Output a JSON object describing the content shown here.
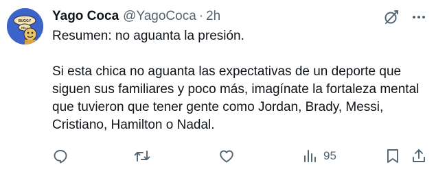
{
  "tweet": {
    "display_name": "Yago Coca",
    "handle": "@YagoCoca",
    "separator": "·",
    "time": "2h",
    "avatar_icon": "cartoon-character-avatar",
    "text": "Resumen: no aguanta la presión.\n\nSi esta chica no aguanta las expectativas de un deporte que siguen sus familiares y poco más, imagínate la fortaleza mental que tuvieron que tener gente como Jordan, Brady, Messi, Cristiano, Hamilton o Nadal."
  },
  "header_actions": {
    "grok_icon": "grok-icon",
    "more_icon": "more-icon"
  },
  "actions": {
    "reply_icon": "reply-icon",
    "retweet_icon": "retweet-icon",
    "like_icon": "like-icon",
    "views_icon": "views-icon",
    "views_count": "95",
    "bookmark_icon": "bookmark-icon",
    "share_icon": "share-icon"
  },
  "colors": {
    "text_primary": "#0f1419",
    "text_secondary": "#536471",
    "avatar_bg": "#3b63c9"
  }
}
